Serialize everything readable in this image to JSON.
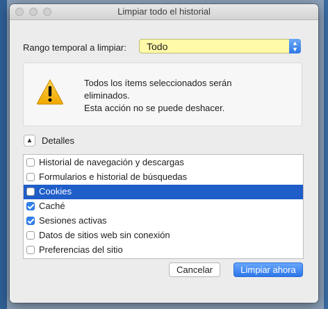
{
  "window": {
    "title": "Limpiar todo el historial"
  },
  "range": {
    "label": "Rango temporal a limpiar:",
    "value": "Todo"
  },
  "warning": {
    "icon": "warning-triangle-icon",
    "line1": "Todos los ítems seleccionados serán",
    "line2": "eliminados.",
    "line3": "Esta acción no se puede deshacer."
  },
  "details": {
    "label": "Detalles",
    "expanded": true
  },
  "items": [
    {
      "label": "Historial de navegación y descargas",
      "checked": false,
      "selected": false
    },
    {
      "label": "Formularios e historial de búsquedas",
      "checked": false,
      "selected": false
    },
    {
      "label": "Cookies",
      "checked": false,
      "selected": true
    },
    {
      "label": "Caché",
      "checked": true,
      "selected": false
    },
    {
      "label": "Sesiones activas",
      "checked": true,
      "selected": false
    },
    {
      "label": "Datos de sitios web sin conexión",
      "checked": false,
      "selected": false
    },
    {
      "label": "Preferencias del sitio",
      "checked": false,
      "selected": false
    }
  ],
  "buttons": {
    "cancel": "Cancelar",
    "clear": "Limpiar ahora"
  },
  "colors": {
    "accent": "#2f78e6",
    "selection": "#1f5dc9",
    "select_highlight": "#fff9a8"
  }
}
